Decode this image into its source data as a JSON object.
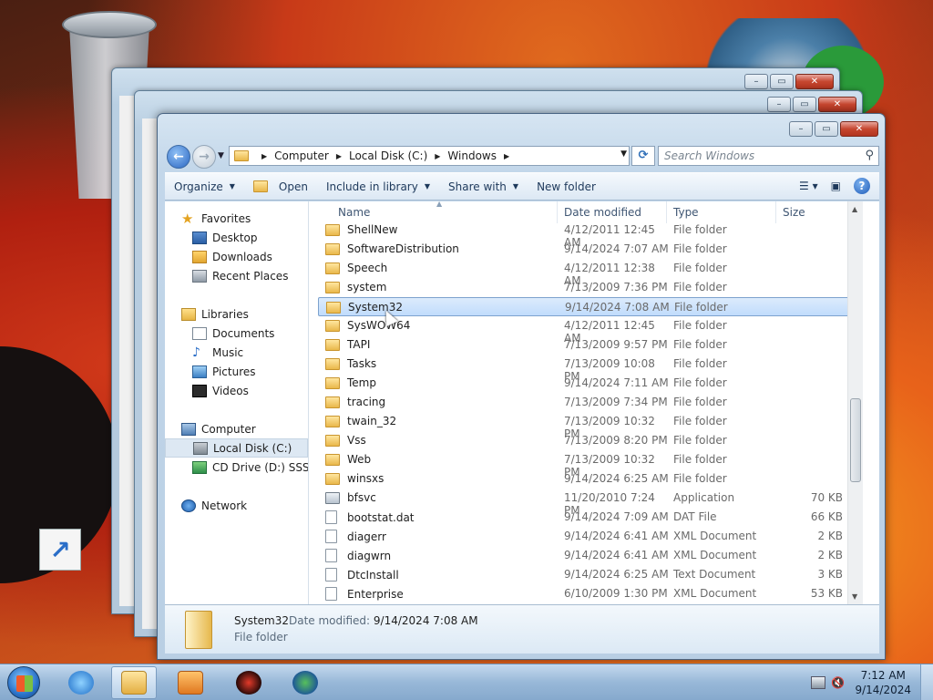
{
  "window": {
    "title": "Windows",
    "caption_buttons": [
      "minimize",
      "maximize",
      "close"
    ]
  },
  "address_bar": {
    "breadcrumbs": [
      "Computer",
      "Local Disk (C:)",
      "Windows"
    ]
  },
  "search": {
    "placeholder": "Search Windows"
  },
  "toolbar": {
    "organize": "Organize",
    "open": "Open",
    "include_in_library": "Include in library",
    "share_with": "Share with",
    "new_folder": "New folder"
  },
  "nav_pane": {
    "favorites": {
      "label": "Favorites",
      "items": [
        "Desktop",
        "Downloads",
        "Recent Places"
      ]
    },
    "libraries": {
      "label": "Libraries",
      "items": [
        "Documents",
        "Music",
        "Pictures",
        "Videos"
      ]
    },
    "computer": {
      "label": "Computer",
      "items": [
        "Local Disk (C:)",
        "CD Drive (D:) SSS_X6"
      ]
    },
    "network": {
      "label": "Network"
    }
  },
  "columns": {
    "name": "Name",
    "date_modified": "Date modified",
    "type": "Type",
    "size": "Size"
  },
  "files": [
    {
      "name": "ShellNew",
      "date": "4/12/2011 12:45 AM",
      "type": "File folder",
      "size": "",
      "icon": "folder-icon"
    },
    {
      "name": "SoftwareDistribution",
      "date": "9/14/2024 7:07 AM",
      "type": "File folder",
      "size": "",
      "icon": "folder-icon"
    },
    {
      "name": "Speech",
      "date": "4/12/2011 12:38 AM",
      "type": "File folder",
      "size": "",
      "icon": "folder-icon"
    },
    {
      "name": "system",
      "date": "7/13/2009 7:36 PM",
      "type": "File folder",
      "size": "",
      "icon": "folder-icon"
    },
    {
      "name": "System32",
      "date": "9/14/2024 7:08 AM",
      "type": "File folder",
      "size": "",
      "icon": "folder-icon",
      "selected": true
    },
    {
      "name": "SysWOW64",
      "date": "4/12/2011 12:45 AM",
      "type": "File folder",
      "size": "",
      "icon": "folder-icon"
    },
    {
      "name": "TAPI",
      "date": "7/13/2009 9:57 PM",
      "type": "File folder",
      "size": "",
      "icon": "folder-icon"
    },
    {
      "name": "Tasks",
      "date": "7/13/2009 10:08 PM",
      "type": "File folder",
      "size": "",
      "icon": "folder-icon"
    },
    {
      "name": "Temp",
      "date": "9/14/2024 7:11 AM",
      "type": "File folder",
      "size": "",
      "icon": "folder-icon"
    },
    {
      "name": "tracing",
      "date": "7/13/2009 7:34 PM",
      "type": "File folder",
      "size": "",
      "icon": "folder-icon"
    },
    {
      "name": "twain_32",
      "date": "7/13/2009 10:32 PM",
      "type": "File folder",
      "size": "",
      "icon": "folder-icon"
    },
    {
      "name": "Vss",
      "date": "7/13/2009 8:20 PM",
      "type": "File folder",
      "size": "",
      "icon": "folder-icon"
    },
    {
      "name": "Web",
      "date": "7/13/2009 10:32 PM",
      "type": "File folder",
      "size": "",
      "icon": "folder-icon"
    },
    {
      "name": "winsxs",
      "date": "9/14/2024 6:25 AM",
      "type": "File folder",
      "size": "",
      "icon": "folder-icon"
    },
    {
      "name": "bfsvc",
      "date": "11/20/2010 7:24 PM",
      "type": "Application",
      "size": "70 KB",
      "icon": "application-icon"
    },
    {
      "name": "bootstat.dat",
      "date": "9/14/2024 7:09 AM",
      "type": "DAT File",
      "size": "66 KB",
      "icon": "file-icon"
    },
    {
      "name": "diagerr",
      "date": "9/14/2024 6:41 AM",
      "type": "XML Document",
      "size": "2 KB",
      "icon": "xml-file-icon"
    },
    {
      "name": "diagwrn",
      "date": "9/14/2024 6:41 AM",
      "type": "XML Document",
      "size": "2 KB",
      "icon": "xml-file-icon"
    },
    {
      "name": "DtcInstall",
      "date": "9/14/2024 6:25 AM",
      "type": "Text Document",
      "size": "3 KB",
      "icon": "text-file-icon"
    },
    {
      "name": "Enterprise",
      "date": "6/10/2009 1:30 PM",
      "type": "XML Document",
      "size": "53 KB",
      "icon": "xml-file-icon"
    }
  ],
  "details_pane": {
    "name": "System32",
    "date_label": "Date modified:",
    "date_value": "9/14/2024 7:08 AM",
    "type": "File folder"
  },
  "taskbar": {
    "clock_time": "7:12 AM",
    "clock_date": "9/14/2024",
    "pinned": [
      "internet-explorer-icon",
      "windows-explorer-icon",
      "media-player-icon",
      "red-app-icon",
      "globe-app-icon"
    ]
  },
  "colors": {
    "selection": "#c1dcfc",
    "accent": "#2a66c2"
  }
}
